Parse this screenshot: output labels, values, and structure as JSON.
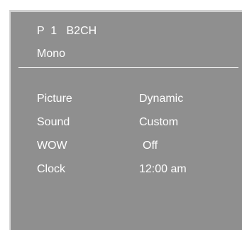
{
  "header": {
    "channel_info": "P  1   B2CH",
    "audio_mode": "Mono"
  },
  "menu": {
    "items": [
      {
        "label": "Picture",
        "value": "Dynamic"
      },
      {
        "label": "Sound",
        "value": "Custom"
      },
      {
        "label": "WOW",
        "value": "Off"
      },
      {
        "label": "Clock",
        "value": "12:00 am"
      }
    ]
  },
  "colors": {
    "panel_background": "#8f8f8f",
    "text": "#ffffff",
    "divider": "#ffffff"
  }
}
